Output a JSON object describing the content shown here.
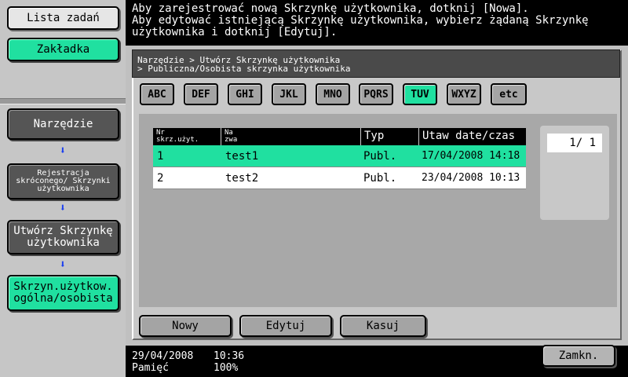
{
  "left": {
    "job_list": "Lista zadań",
    "bookmark": "Zakładka",
    "utility": "Narzędzie",
    "registration": "Rejestracja skróconego/ Skrzynki użytkownika",
    "create_box": "Utwórz Skrzynkę użytkownika",
    "public_box": "Skrzyn.użytkow. ogólna/osobista",
    "arrow": "⬇"
  },
  "message": "Aby zarejestrować nową Skrzynkę użytkownika, dotknij [Nowa].\nAby edytować istniejącą Skrzynkę użytkownika, wybierz żądaną Skrzynkę\nużytkownika i dotknij [Edytuj].",
  "breadcrumb": {
    "line1": "Narzędzie > Utwórz Skrzynkę użytkownika",
    "line2": "> Publiczna/Osobista skrzynka użytkownika"
  },
  "alpha_tabs": [
    "ABC",
    "DEF",
    "GHI",
    "JKL",
    "MNO",
    "PQRS",
    "TUV",
    "WXYZ",
    "etc"
  ],
  "selected_tab": "TUV",
  "table": {
    "headers": {
      "box_no_1": "Nr",
      "box_no_2": "skrz.użyt.",
      "name_1": "Na",
      "name_2": "zwa",
      "type": "Typ",
      "datetime": "Utaw date/czas"
    },
    "rows": [
      {
        "no": "1",
        "name": "test1",
        "type": "Publ.",
        "datetime": "17/04/2008 14:18",
        "selected": true
      },
      {
        "no": "2",
        "name": "test2",
        "type": "Publ.",
        "datetime": "23/04/2008 10:13",
        "selected": false
      }
    ]
  },
  "page": "1/  1",
  "buttons": {
    "new": "Nowy",
    "edit": "Edytuj",
    "delete": "Kasuj",
    "close": "Zamkn."
  },
  "status": {
    "date": "29/04/2008",
    "time": "10:36",
    "memory_label": "Pamięć",
    "memory_value": "100%"
  },
  "colors": {
    "accent_green": "#20e0a0",
    "arrow_blue": "#1a3ef0"
  }
}
